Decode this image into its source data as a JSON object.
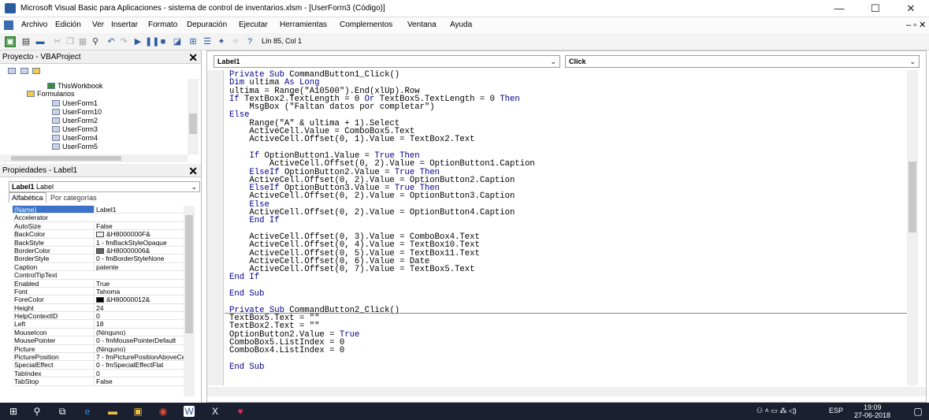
{
  "window": {
    "title": "Microsoft Visual Basic para Aplicaciones - sistema de control de inventarios.xlsm - [UserForm3 (Código)]",
    "min_label": "—",
    "max_label": "☐",
    "close_label": "✕"
  },
  "menu": [
    "Archivo",
    "Edición",
    "Ver",
    "Insertar",
    "Formato",
    "Depuración",
    "Ejecutar",
    "Herramientas",
    "Complementos",
    "Ventana",
    "Ayuda"
  ],
  "toolbar": {
    "position": "Lín 85, Col 1"
  },
  "project": {
    "title": "Proyecto - VBAProject",
    "items": [
      "ThisWorkbook",
      "Formularios",
      "UserForm1",
      "UserForm10",
      "UserForm2",
      "UserForm3",
      "UserForm4",
      "UserForm5"
    ]
  },
  "properties": {
    "title": "Propiedades - Label1",
    "object": "Label1",
    "object_type": "Label",
    "tabs": [
      "Alfabética",
      "Por categorías"
    ],
    "rows": [
      [
        "(Name)",
        "Label1"
      ],
      [
        "Accelerator",
        ""
      ],
      [
        "AutoSize",
        "False"
      ],
      [
        "BackColor",
        "&H8000000F&"
      ],
      [
        "BackStyle",
        "1 - fmBackStyleOpaque"
      ],
      [
        "BorderColor",
        "&H80000006&"
      ],
      [
        "BorderStyle",
        "0 - fmBorderStyleNone"
      ],
      [
        "Caption",
        "patente"
      ],
      [
        "ControlTipText",
        ""
      ],
      [
        "Enabled",
        "True"
      ],
      [
        "Font",
        "Tahoma"
      ],
      [
        "ForeColor",
        "&H80000012&"
      ],
      [
        "Height",
        "24"
      ],
      [
        "HelpContextID",
        "0"
      ],
      [
        "Left",
        "18"
      ],
      [
        "MouseIcon",
        "(Ninguno)"
      ],
      [
        "MousePointer",
        "0 - fmMousePointerDefault"
      ],
      [
        "Picture",
        "(Ninguno)"
      ],
      [
        "PicturePosition",
        "7 - fmPicturePositionAboveCen"
      ],
      [
        "SpecialEffect",
        "0 - fmSpecialEffectFlat"
      ],
      [
        "TabIndex",
        "0"
      ],
      [
        "TabStop",
        "False"
      ]
    ]
  },
  "code": {
    "object_combo": "Label1",
    "proc_combo": "Click",
    "lines": [
      "Private Sub CommandButton1_Click()",
      "Dim ultima As Long",
      "ultima = Range(\"A10500\").End(xlUp).Row",
      "If TextBox2.TextLength = 0 Or TextBox5.TextLength = 0 Then",
      "    MsgBox (\"Faltan datos por completar\")",
      "Else",
      "    Range(\"A\" & ultima + 1).Select",
      "    ActiveCell.Value = ComboBox5.Text",
      "    ActiveCell.Offset(0, 1).Value = TextBox2.Text",
      "",
      "    If OptionButton1.Value = True Then",
      "        ActiveCell.Offset(0, 2).Value = OptionButton1.Caption",
      "    ElseIf OptionButton2.Value = True Then",
      "    ActiveCell.Offset(0, 2).Value = OptionButton2.Caption",
      "    ElseIf OptionButton3.Value = True Then",
      "    ActiveCell.Offset(0, 2).Value = OptionButton3.Caption",
      "    Else",
      "    ActiveCell.Offset(0, 2).Value = OptionButton4.Caption",
      "    End If",
      "",
      "    ActiveCell.Offset(0, 3).Value = ComboBox4.Text",
      "    ActiveCell.Offset(0, 4).Value = TextBox10.Text",
      "    ActiveCell.Offset(0, 5).Value = TextBox11.Text",
      "    ActiveCell.Offset(0, 6).Value = Date",
      "    ActiveCell.Offset(0, 7).Value = TextBox5.Text",
      "End If",
      "",
      "End Sub",
      "",
      "Private Sub CommandButton2_Click()",
      "TextBox5.Text = \"\"",
      "TextBox2.Text = \"\"",
      "OptionButton2.Value = True",
      "ComboBox5.ListIndex = 0",
      "ComboBox4.ListIndex = 0",
      "",
      "End Sub"
    ]
  },
  "taskbar": {
    "lang": "ESP",
    "time": "19:09",
    "date": "27-06-2018"
  },
  "icons": {
    "app": "vba-icon",
    "search": "search-icon",
    "folder": "folder-icon"
  }
}
